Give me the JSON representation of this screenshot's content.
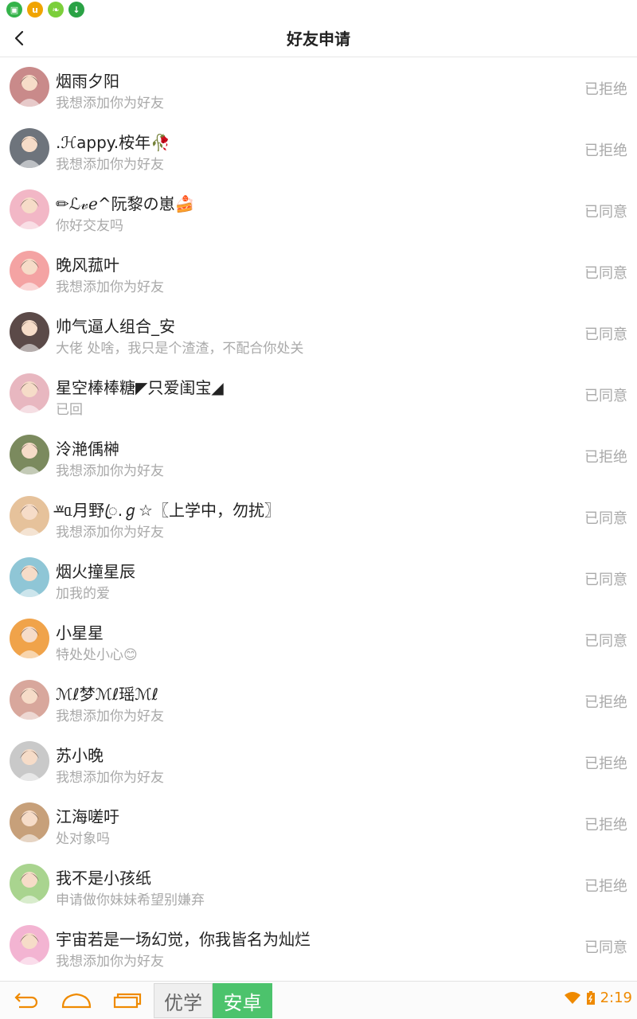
{
  "header": {
    "title": "好友申请"
  },
  "requests": [
    {
      "name": "烟雨夕阳",
      "message": "我想添加你为好友",
      "status": "已拒绝",
      "avatar_color": "#c98a8a"
    },
    {
      "name": "⁢.ℋappy.桉年🥀",
      "message": "我想添加你为好友",
      "status": "已拒绝",
      "avatar_color": "#6e747c"
    },
    {
      "name": "✏ℒ𝓋ℯ^阮黎の崽🍰",
      "message": "你好交友吗",
      "status": "已同意",
      "avatar_color": "#f2b7c6"
    },
    {
      "name": "晚风菰叶",
      "message": "我想添加你为好友",
      "status": "已同意",
      "avatar_color": "#f4a3a3"
    },
    {
      "name": "帅气逼人组合_安",
      "message": "大佬  处啥，我只是个渣渣，不配合你处关",
      "status": "已同意",
      "avatar_color": "#5b4a48"
    },
    {
      "name": "星空棒棒糖◤只爱闺宝◢",
      "message": "已回",
      "status": "已同意",
      "avatar_color": "#e8b7c0"
    },
    {
      "name": "泠滟偊榊",
      "message": "我想添加你为好友",
      "status": "已拒绝",
      "avatar_color": "#7b8a5e"
    },
    {
      "name": "ʷ̶ᥲ月野ꦿ.ℊ☆〖上学中，勿扰〗",
      "message": "我想添加你为好友",
      "status": "已同意",
      "avatar_color": "#e6c29b"
    },
    {
      "name": "烟火撞星辰",
      "message": "加我的爱",
      "status": "已同意",
      "avatar_color": "#8fc6d6"
    },
    {
      "name": "小星星",
      "message": "特处处小心😊",
      "status": "已同意",
      "avatar_color": "#f0a34a"
    },
    {
      "name": "ℳℓ梦ℳℓ瑶ℳℓ",
      "message": "我想添加你为好友",
      "status": "已拒绝",
      "avatar_color": "#d8a79c"
    },
    {
      "name": "苏小晚",
      "message": "我想添加你为好友",
      "status": "已拒绝",
      "avatar_color": "#c9c9c9"
    },
    {
      "name": "江海嗟吁",
      "message": "处对象吗",
      "status": "已拒绝",
      "avatar_color": "#c7a07a"
    },
    {
      "name": "我不是小孩纸",
      "message": "申请做你妹妹希望别嫌弃",
      "status": "已拒绝",
      "avatar_color": "#a9d48f"
    },
    {
      "name": "宇宙若是一场幻觉，你我皆名为灿烂",
      "message": "我想添加你为好友",
      "status": "已同意",
      "avatar_color": "#f3b4d2"
    }
  ],
  "ime": {
    "left": "优学",
    "right": "安卓"
  },
  "system": {
    "time": "2:19"
  },
  "colors": {
    "accent": "#ef8a00",
    "ime_green": "#4cc36c"
  }
}
